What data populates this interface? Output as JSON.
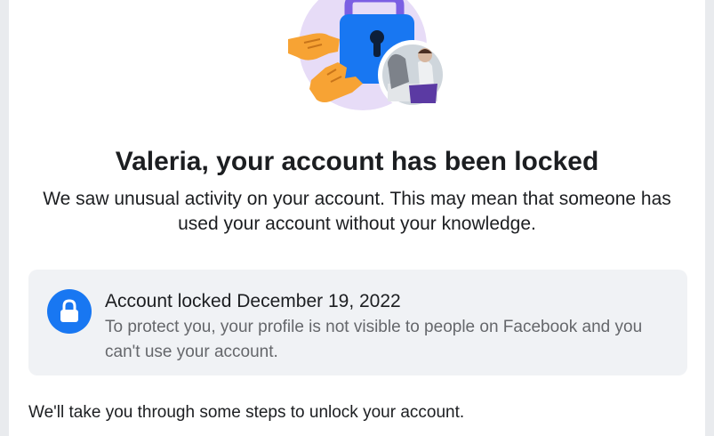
{
  "header": {
    "title": "Valeria, your account has been locked",
    "description": "We saw unusual activity on your account. This may mean that someone has used your account without your knowledge."
  },
  "notice": {
    "icon": "lock-icon",
    "title": "Account locked December 19, 2022",
    "text": "To protect you, your profile is not visible to people on Facebook and you can't use your account."
  },
  "footer": {
    "steps_text": "We'll take you through some steps to unlock your account."
  },
  "illustration": {
    "icons": [
      "hand-icon",
      "padlock-icon",
      "profile-avatar"
    ]
  },
  "colors": {
    "accent": "#1877f2",
    "text": "#1c1e21",
    "secondary_text": "#65676b",
    "notice_bg": "#f0f2f5",
    "hand": "#f7a334",
    "blob": "#e7dcf7"
  }
}
